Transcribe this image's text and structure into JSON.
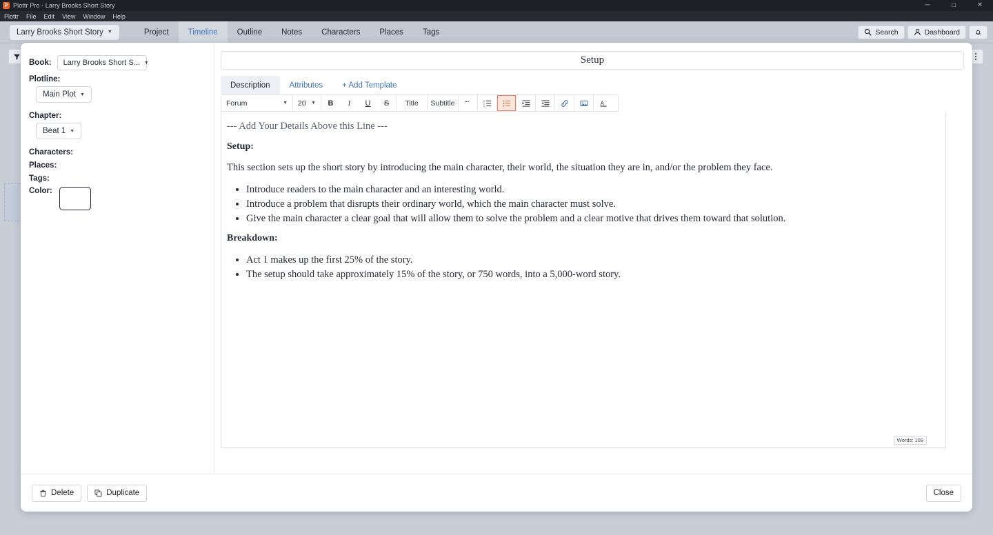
{
  "window": {
    "title": "Plottr Pro - Larry Brooks Short Story",
    "app_initial": "P",
    "controls": {
      "minimize": "─",
      "maximize": "□",
      "close": "✕"
    }
  },
  "menubar": {
    "items": [
      "Plottr",
      "File",
      "Edit",
      "View",
      "Window",
      "Help"
    ]
  },
  "navbar": {
    "book_selector": "Larry Brooks Short Story",
    "tabs": [
      {
        "label": "Project",
        "active": false
      },
      {
        "label": "Timeline",
        "active": true
      },
      {
        "label": "Outline",
        "active": false
      },
      {
        "label": "Notes",
        "active": false
      },
      {
        "label": "Characters",
        "active": false
      },
      {
        "label": "Places",
        "active": false
      },
      {
        "label": "Tags",
        "active": false
      }
    ],
    "search_label": "Search",
    "dashboard_label": "Dashboard",
    "notification_icon": "bell-icon"
  },
  "background": {
    "filter_icon": "filter-icon",
    "overflow_icon": "vertical-dots-icon"
  },
  "modal": {
    "attributes": {
      "book_label": "Book:",
      "book_value": "Larry Brooks Short S...",
      "plotline_label": "Plotline:",
      "plotline_value": "Main Plot",
      "chapter_label": "Chapter:",
      "chapter_value": "Beat 1",
      "characters_label": "Characters:",
      "places_label": "Places:",
      "tags_label": "Tags:",
      "color_label": "Color:",
      "color_value": "#ffffff"
    },
    "card_title": "Setup",
    "tabs": [
      {
        "label": "Description",
        "active": true
      },
      {
        "label": "Attributes",
        "active": false
      },
      {
        "label": "+ Add Template",
        "active": false
      }
    ],
    "toolbar": {
      "font_family": "Forum",
      "font_size": "20",
      "bold": "B",
      "italic": "I",
      "underline": "U",
      "strikethrough": "S",
      "title": "Title",
      "subtitle": "Subtitle",
      "blockquote_icon": "quote-icon",
      "ordered_list_icon": "ordered-list-icon",
      "unordered_list_icon": "unordered-list-icon",
      "indent_icon": "indent-icon",
      "outdent_icon": "outdent-icon",
      "link_icon": "link-icon",
      "image_icon": "image-icon",
      "text_color_icon": "text-color-icon",
      "active_button": "unordered-list-icon",
      "active_color": "#e5825f",
      "active_bg": "#fae6de"
    },
    "document": {
      "divider": "--- Add Your Details Above this Line ---",
      "heading_1": "Setup:",
      "paragraph_1": "This section sets up the short story by introducing the main character, their world, the situation they are in, and/or the problem they face.",
      "list_1": [
        "Introduce readers to the main character and an interesting world.",
        "Introduce a problem that disrupts their ordinary world, which the main character must solve.",
        "Give the main character a clear goal that will allow them to solve the problem and a clear motive that drives them toward that solution."
      ],
      "heading_2": "Breakdown:",
      "list_2": [
        "Act 1 makes up the first 25% of the story.",
        "The setup should take approximately 15% of the story, or 750 words, into a 5,000-word story."
      ],
      "word_count": "Words: 109"
    },
    "footer": {
      "delete_label": "Delete",
      "duplicate_label": "Duplicate",
      "close_label": "Close"
    }
  }
}
